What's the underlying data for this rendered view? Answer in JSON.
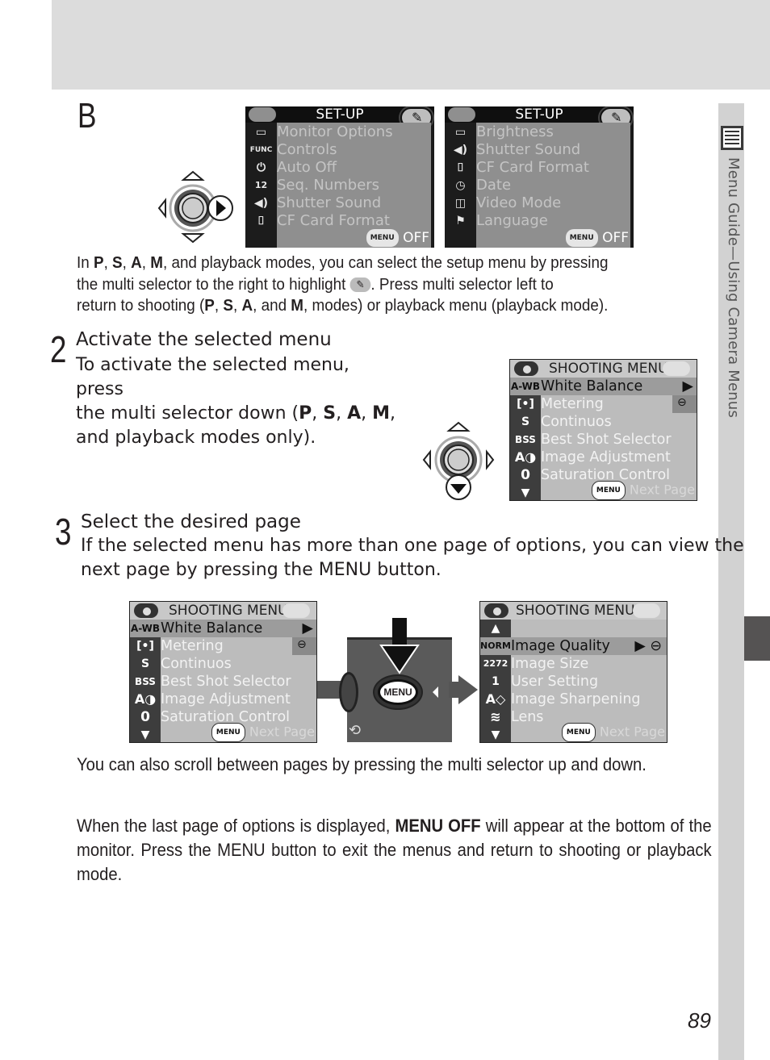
{
  "side_tab": {
    "label": "Menu Guide—Using Camera Menus",
    "icon": "menu-list-icon"
  },
  "section_b": {
    "letter": "B",
    "setup_menu_shooting": {
      "mode_icon": "camera-icon",
      "title": "SET-UP",
      "tab_icon": "wrench-icon",
      "items": [
        {
          "icon": "monitor-icon",
          "label": "Monitor Options"
        },
        {
          "icon": "func-icon",
          "icon_text": "FUNC",
          "label": "Controls"
        },
        {
          "icon": "power-icon",
          "label": "Auto Off"
        },
        {
          "icon": "sequence-icon",
          "icon_text": "12",
          "label": "Seq.  Numbers"
        },
        {
          "icon": "speaker-icon",
          "label": "Shutter Sound"
        },
        {
          "icon": "card-icon",
          "label": "CF Card Format"
        }
      ],
      "footer_button": "MENU",
      "footer_text": "OFF"
    },
    "setup_menu_playback": {
      "mode_icon": "playback-icon",
      "title": "SET-UP",
      "tab_icon": "wrench-icon",
      "items": [
        {
          "icon": "monitor-icon",
          "label": "Brightness"
        },
        {
          "icon": "speaker-icon",
          "label": "Shutter Sound"
        },
        {
          "icon": "card-icon",
          "label": "CF Card Format"
        },
        {
          "icon": "clock-icon",
          "label": "Date"
        },
        {
          "icon": "video-icon",
          "label": "Video Mode"
        },
        {
          "icon": "language-icon",
          "label": "Language"
        }
      ],
      "footer_button": "MENU",
      "footer_text": "OFF"
    },
    "paragraph": {
      "l1_pre": "In ",
      "P": "P",
      "S": "S",
      "A": "A",
      "M": "M",
      "l1_post": ", and playback modes, you can select the setup menu by pressing",
      "l2": "the multi selector to the right to highlight",
      "l2_post": ".  Press multi selector left to",
      "l3_pre": "return to shooting (",
      "l3_mid": ", and ",
      "l3_post": ", modes) or playback menu (playback mode)."
    }
  },
  "step2": {
    "number": "2",
    "title": "Activate the selected menu",
    "line1": "To activate the selected menu, press",
    "line2_pre": "the multi selector down (",
    "line3": "and playback modes only).",
    "modes": [
      "P",
      "S",
      "A",
      "M"
    ]
  },
  "shooting_menu_page1": {
    "title": "SHOOTING MENU",
    "items": [
      {
        "icon_text": "A-WB",
        "label": "White Balance",
        "selected": true
      },
      {
        "icon": "metering-icon",
        "icon_text": "[•]",
        "label": "Metering"
      },
      {
        "icon": "continuous-icon",
        "icon_text": "S",
        "label": "Continuos"
      },
      {
        "icon": "bss-icon",
        "icon_text": "BSS",
        "label": "Best Shot Selector"
      },
      {
        "icon": "image-adjust-icon",
        "icon_text": "A◑",
        "label": "Image Adjustment"
      },
      {
        "icon": "saturation-icon",
        "icon_text": "0",
        "label": "Saturation Control"
      }
    ],
    "footer_button": "MENU",
    "footer_text": "Next Page"
  },
  "step3": {
    "number": "3",
    "title": "Select the desired page",
    "line1": "If the selected menu has more than one page of options, you can view the",
    "line2_pre": "next page by pressing the ",
    "line2_bold": "MENU",
    "line2_post": " button."
  },
  "camera_button": {
    "label": "MENU"
  },
  "shooting_menu_page2": {
    "title": "SHOOTING  MENU",
    "items": [
      {
        "icon_text": "NORM",
        "label": "Image Quality",
        "selected": true
      },
      {
        "icon_text": "2272",
        "label": "Image Size"
      },
      {
        "icon_text": "1",
        "label": "User Setting"
      },
      {
        "icon_text": "A◇",
        "label": "Image Sharpening"
      },
      {
        "icon": "lens-icon",
        "icon_text": "≋",
        "label": "Lens"
      }
    ],
    "footer_button": "MENU",
    "footer_text": "Next Page"
  },
  "note1": "You can also scroll between pages by pressing the multi selector up and down.",
  "note2": {
    "pre": "When the last page of options is displayed, ",
    "bold": "MENU OFF",
    "mid": " will appear at the bottom of the monitor.  Press the ",
    "bold2": "MENU",
    "post": " button to exit the menus and return to shooting or playback mode."
  },
  "page_number": "89"
}
